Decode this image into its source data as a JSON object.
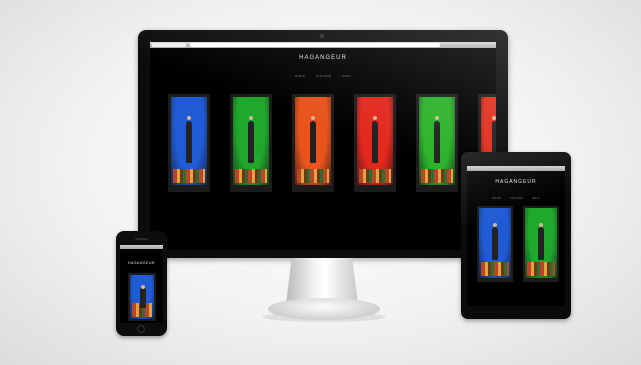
{
  "site": {
    "logo": "HAGANGEUR",
    "nav": [
      "SHOP",
      "VISIONS",
      "INFO"
    ],
    "footer_left": "",
    "footer_right": ""
  },
  "windows": {
    "colors": [
      "#1f5bd4",
      "#1fa82c",
      "#e8541c",
      "#e3281e",
      "#2cb32a",
      "#e2301e"
    ]
  },
  "tablet_windows": {
    "colors": [
      "#1f5bd4",
      "#1fa82c"
    ]
  },
  "phone_window": {
    "colors": [
      "#1f5bd4"
    ]
  }
}
